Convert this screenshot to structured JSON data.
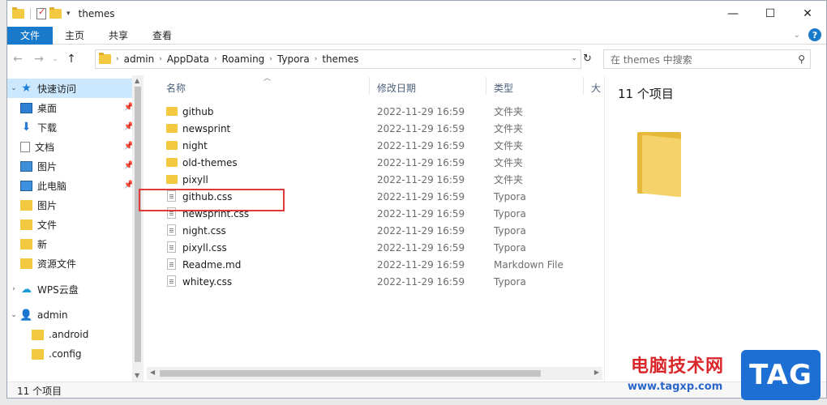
{
  "window": {
    "title": "themes",
    "controls": {
      "minimize": "—",
      "maximize": "☐",
      "close": "✕"
    }
  },
  "ribbon": {
    "tabs": [
      {
        "label": "文件"
      },
      {
        "label": "主页"
      },
      {
        "label": "共享"
      },
      {
        "label": "查看"
      }
    ],
    "help": "?"
  },
  "address": {
    "crumbs": [
      "admin",
      "AppData",
      "Roaming",
      "Typora",
      "themes"
    ],
    "search_placeholder": "在 themes 中搜索"
  },
  "nav": {
    "quick_access": "快速访问",
    "items": [
      {
        "label": "桌面",
        "icon": "desktop-icon",
        "pinned": true
      },
      {
        "label": "下载",
        "icon": "download-icon",
        "pinned": true
      },
      {
        "label": "文档",
        "icon": "document-icon",
        "pinned": true
      },
      {
        "label": "图片",
        "icon": "pictures-icon",
        "pinned": true
      },
      {
        "label": "此电脑",
        "icon": "computer-icon",
        "pinned": true
      },
      {
        "label": "图片",
        "icon": "folder-icon",
        "pinned": false
      },
      {
        "label": "文件",
        "icon": "folder-icon",
        "pinned": false
      },
      {
        "label": "新",
        "icon": "folder-icon",
        "pinned": false
      },
      {
        "label": "资源文件",
        "icon": "folder-icon",
        "pinned": false
      }
    ],
    "wps": "WPS云盘",
    "admin": "admin",
    "admin_children": [
      {
        "label": ".android"
      },
      {
        "label": ".config"
      }
    ]
  },
  "columns": {
    "name": "名称",
    "date": "修改日期",
    "type": "类型",
    "size": "大小"
  },
  "files": [
    {
      "name": "github",
      "date": "2022-11-29 16:59",
      "type": "文件夹",
      "kind": "folder"
    },
    {
      "name": "newsprint",
      "date": "2022-11-29 16:59",
      "type": "文件夹",
      "kind": "folder"
    },
    {
      "name": "night",
      "date": "2022-11-29 16:59",
      "type": "文件夹",
      "kind": "folder"
    },
    {
      "name": "old-themes",
      "date": "2022-11-29 16:59",
      "type": "文件夹",
      "kind": "folder"
    },
    {
      "name": "pixyll",
      "date": "2022-11-29 16:59",
      "type": "文件夹",
      "kind": "folder"
    },
    {
      "name": "github.css",
      "date": "2022-11-29 16:59",
      "type": "Typora",
      "kind": "file"
    },
    {
      "name": "newsprint.css",
      "date": "2022-11-29 16:59",
      "type": "Typora",
      "kind": "file"
    },
    {
      "name": "night.css",
      "date": "2022-11-29 16:59",
      "type": "Typora",
      "kind": "file"
    },
    {
      "name": "pixyll.css",
      "date": "2022-11-29 16:59",
      "type": "Typora",
      "kind": "file"
    },
    {
      "name": "Readme.md",
      "date": "2022-11-29 16:59",
      "type": "Markdown File",
      "kind": "file"
    },
    {
      "name": "whitey.css",
      "date": "2022-11-29 16:59",
      "type": "Typora",
      "kind": "file"
    }
  ],
  "preview": {
    "count": "11 个项目"
  },
  "status": {
    "count": "11 个项目"
  },
  "watermark": {
    "line1": "电脑技术网",
    "line2": "www.tagxp.com",
    "tag": "TAG"
  },
  "colors": {
    "accent": "#1979ca",
    "selection": "#cce8ff",
    "highlight": "#e23a3a"
  }
}
